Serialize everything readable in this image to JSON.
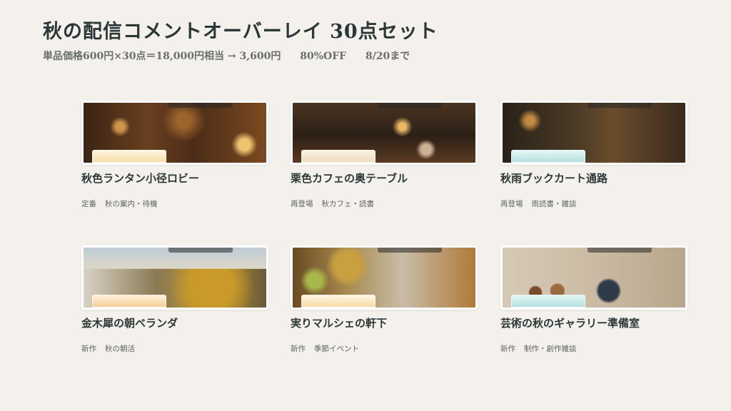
{
  "header": {
    "title": "秋の配信コメントオーバーレイ 30点セット",
    "subtitle_price": "単品価格600円×30点＝18,000円相当 → 3,600円",
    "subtitle_discount": "80%OFF",
    "subtitle_deadline": "8/20まで"
  },
  "cards": [
    {
      "title": "秋色ランタン小径ロビー",
      "tag1": "定番",
      "tag2": "秋の案内・待機",
      "image": "autumn-lantern-lobby-image"
    },
    {
      "title": "栗色カフェの奥テーブル",
      "tag1": "再登場",
      "tag2": "秋カフェ・読書",
      "image": "chestnut-cafe-table-image"
    },
    {
      "title": "秋雨ブックカート通路",
      "tag1": "再登場",
      "tag2": "雨読書・雑談",
      "image": "rainy-book-cart-corridor-image"
    },
    {
      "title": "金木犀の朝ベランダ",
      "tag1": "新作",
      "tag2": "秋の朝活",
      "image": "osmanthus-morning-veranda-image"
    },
    {
      "title": "実りマルシェの軒下",
      "tag1": "新作",
      "tag2": "季節イベント",
      "image": "harvest-marche-eaves-image"
    },
    {
      "title": "芸術の秋のギャラリー準備室",
      "tag1": "新作",
      "tag2": "制作・創作雑談",
      "image": "art-gallery-prep-room-image"
    }
  ]
}
